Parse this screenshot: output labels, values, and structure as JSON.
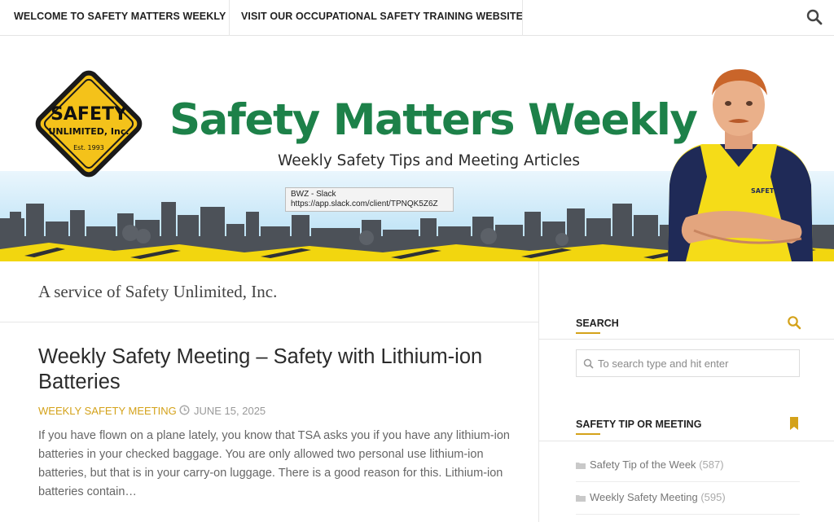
{
  "nav": {
    "items": [
      {
        "label": "WELCOME TO SAFETY MATTERS WEEKLY"
      },
      {
        "label": "VISIT OUR OCCUPATIONAL SAFETY TRAINING WEBSITE"
      }
    ],
    "search_icon": "search-icon"
  },
  "banner": {
    "logo": {
      "line1": "SAFETY",
      "line2": "UNLIMITED, Inc.",
      "line3": "Est. 1993"
    },
    "title": "Safety Matters Weekly",
    "subtitle": "Weekly Safety Tips and Meeting Articles",
    "mascot_vest_text": "SAFETY",
    "colors": {
      "title": "#1d8149",
      "logo_yellow": "#f4c21a",
      "skyline": "#4a4f56",
      "stripe_yellow": "#f2d60f"
    }
  },
  "tooltip": {
    "line1": "BWZ - Slack",
    "line2": "https://app.slack.com/client/TPNQK5Z6Z"
  },
  "main": {
    "tagline": "A service of Safety Unlimited, Inc.",
    "post": {
      "title": "Weekly Safety Meeting – Safety with Lithium-ion Batteries",
      "category": "WEEKLY SAFETY MEETING",
      "date": "JUNE 15, 2025",
      "excerpt": "If you have flown on a plane lately, you know that TSA asks you if you have any lithium-ion batteries in your checked baggage. You are only allowed two personal use lithium-ion batteries, but that is in your carry-on luggage. There is a good reason for this. Lithium-ion batteries contain…"
    }
  },
  "sidebar": {
    "search": {
      "title": "SEARCH",
      "placeholder": "To search type and hit enter"
    },
    "categories": {
      "title": "SAFETY TIP OR MEETING",
      "items": [
        {
          "label": "Safety Tip of the Week",
          "count": "(587)"
        },
        {
          "label": "Weekly Safety Meeting",
          "count": "(595)"
        }
      ]
    },
    "accent_color": "#d4a21a"
  }
}
